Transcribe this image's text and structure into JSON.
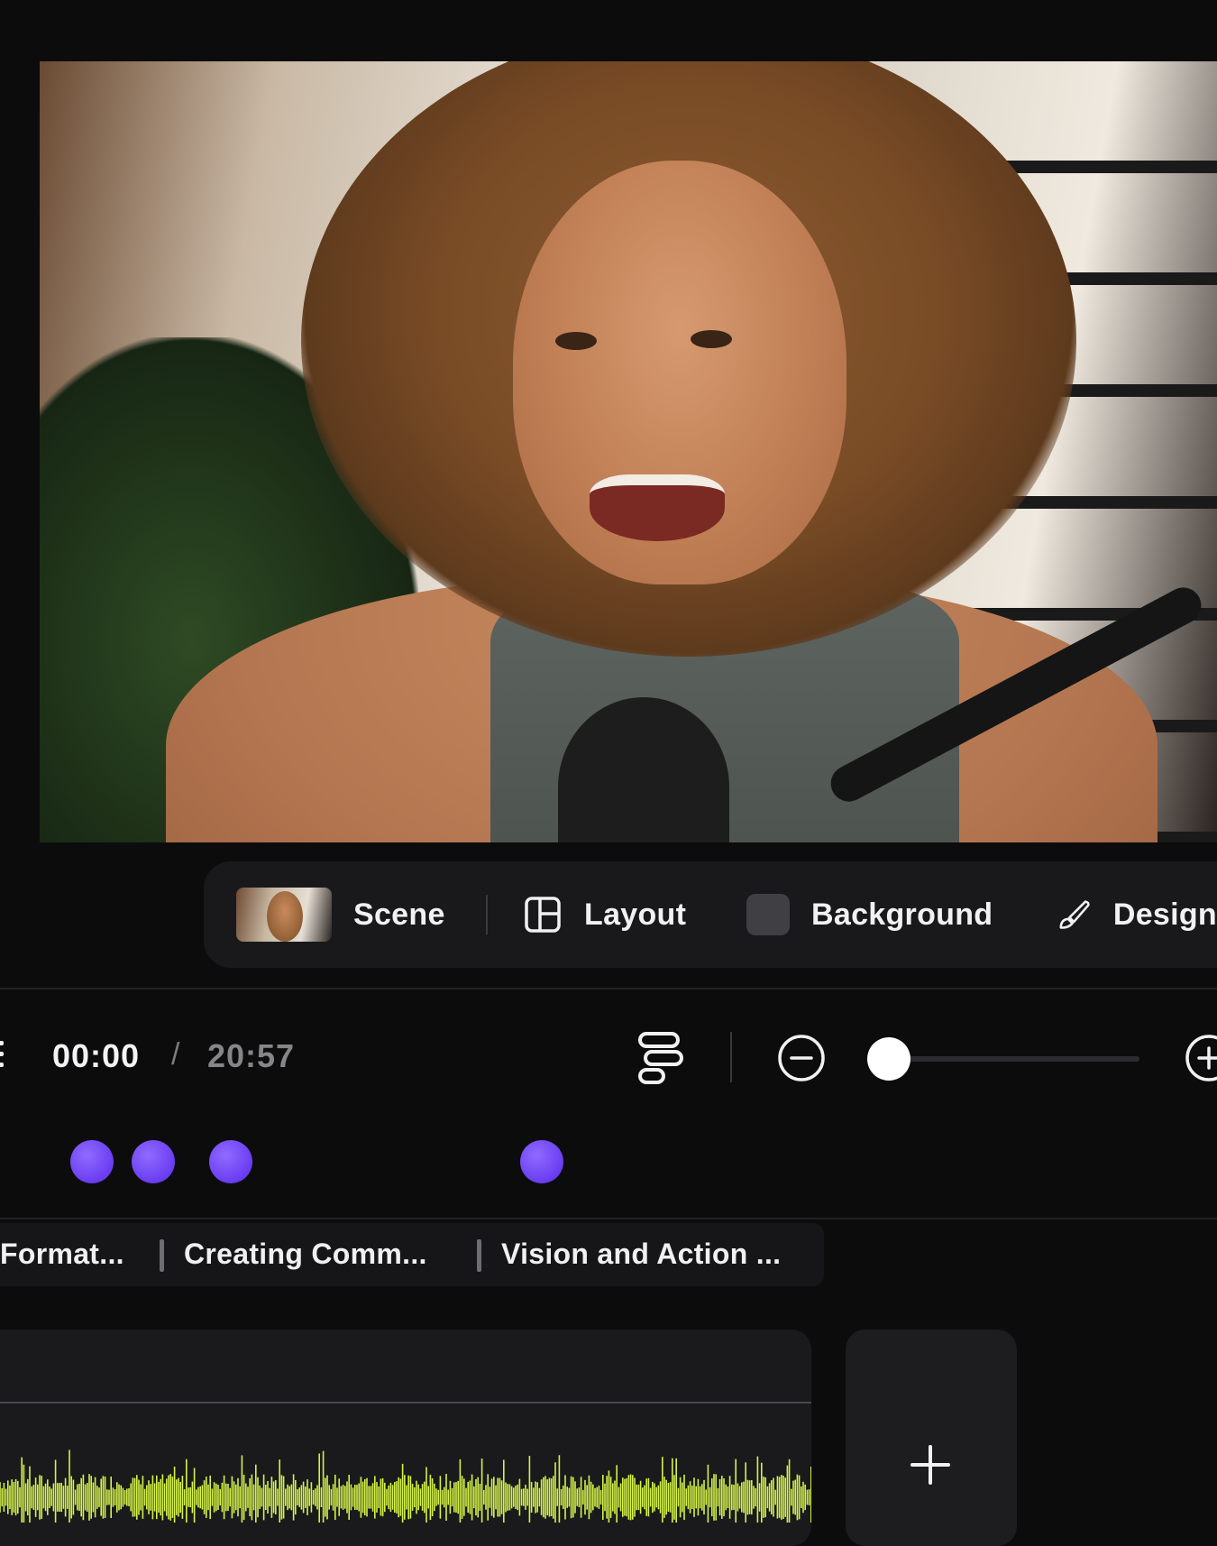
{
  "toolbar": {
    "scene_label": "Scene",
    "layout_label": "Layout",
    "background_label": "Background",
    "design_label": "Design"
  },
  "playback": {
    "current_time": "00:00",
    "separator": "/",
    "total_time": "20:57",
    "zoom_level": 0
  },
  "markers": {
    "count": 4,
    "color": "#6a3df2"
  },
  "chapters": [
    {
      "label": "Format..."
    },
    {
      "label": "Creating Comm..."
    },
    {
      "label": "Vision and Action ..."
    }
  ],
  "icons": {
    "layout": "layout-grid-icon",
    "design": "brush-icon",
    "align": "align-icon",
    "zoom_out": "minus-circle-icon",
    "zoom_in": "plus-circle-icon",
    "add": "plus-icon"
  },
  "colors": {
    "waveform": "#d4f24a",
    "accent_marker": "#6a3df2",
    "panel": "#19191b"
  }
}
